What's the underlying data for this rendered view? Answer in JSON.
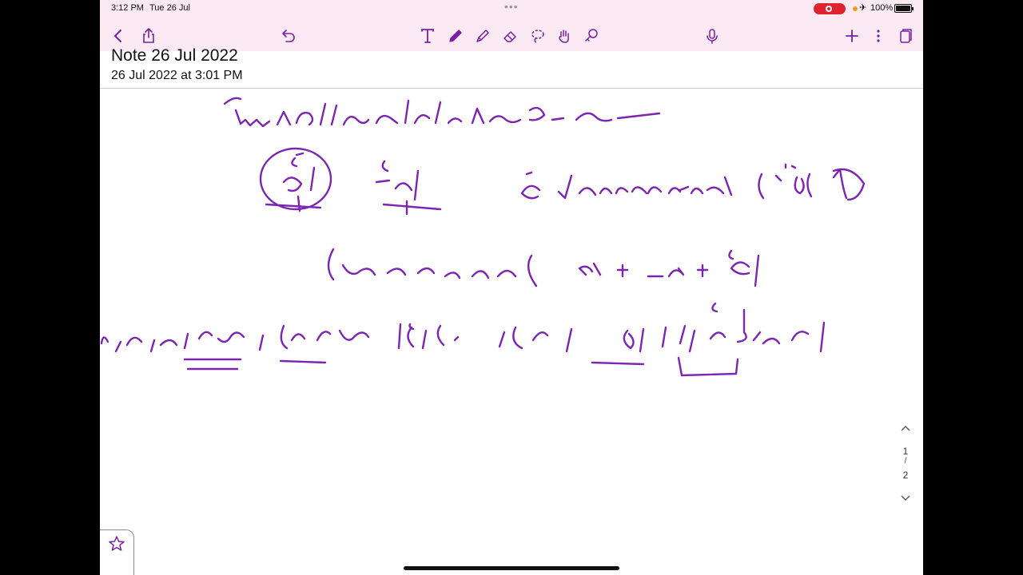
{
  "status_bar": {
    "time": "3:12 PM",
    "date": "Tue 26 Jul",
    "battery": "100%",
    "recording_color": "#e0242f"
  },
  "toolbar": {
    "accent": "#7a1fa2",
    "background": "#fbeaf4",
    "left_icons": [
      "back-chevron-icon",
      "share-icon",
      "undo-icon"
    ],
    "tools": [
      "text-tool-icon",
      "pen-tool-icon",
      "highlighter-tool-icon",
      "eraser-tool-icon",
      "lasso-tool-icon",
      "hand-tool-icon",
      "shape-tool-icon"
    ],
    "right_icons": [
      "microphone-icon",
      "add-icon",
      "more-icon",
      "pages-icon"
    ]
  },
  "note": {
    "title": "Note 26 Jul 2022",
    "date": "26 Jul 2022 at 3:01 PM"
  },
  "ink": {
    "color": "#7b25b0",
    "lines": [
      "رسم بعض الكلمات المفصولة خطأ",
      "① (أنْ) المخففة من الثقيلة إنّ أنّ أنْ",
      "أنْ + لا + اسم (يجب الفصل)",
      "أشهد أنْ لا إله إلا الله . (عملة أنْ لا دائمة دون تقييد)"
    ]
  },
  "pagination": {
    "current": "1",
    "separator": "/",
    "total": "2"
  }
}
